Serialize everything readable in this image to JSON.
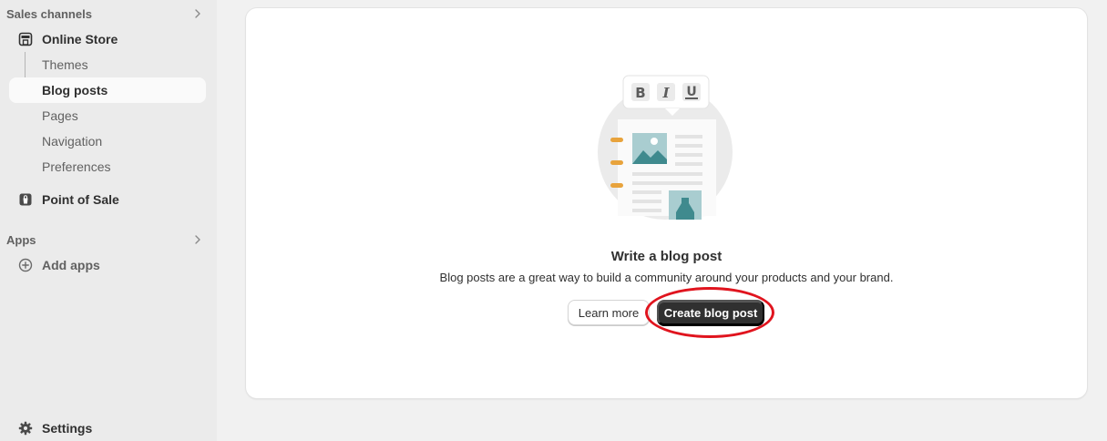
{
  "sidebar": {
    "sales_channels": {
      "label": "Sales channels",
      "icon": "chevron-right-icon"
    },
    "online_store": {
      "label": "Online Store",
      "icon": "store-icon"
    },
    "sub_items": [
      {
        "label": "Themes"
      },
      {
        "label": "Blog posts",
        "active": true
      },
      {
        "label": "Pages"
      },
      {
        "label": "Navigation"
      },
      {
        "label": "Preferences"
      }
    ],
    "point_of_sale": {
      "label": "Point of Sale",
      "icon": "pos-icon"
    },
    "apps": {
      "label": "Apps",
      "icon": "chevron-right-icon"
    },
    "add_apps": {
      "label": "Add apps",
      "icon": "plus-circle-icon"
    },
    "settings": {
      "label": "Settings",
      "icon": "gear-icon"
    }
  },
  "empty_state": {
    "title": "Write a blog post",
    "description": "Blog posts are a great way to build a community around your products and your brand.",
    "learn_more_label": "Learn more",
    "create_label": "Create blog post",
    "illustration_toolbar": [
      "B",
      "I",
      "U"
    ]
  },
  "colors": {
    "sidebar_bg": "#ebebeb",
    "page_bg": "#f1f1f1",
    "primary_button": "#303030",
    "annotation_circle": "#e0141e",
    "illustration_teal": "#3f8a8e",
    "illustration_orange": "#e8a33c"
  }
}
